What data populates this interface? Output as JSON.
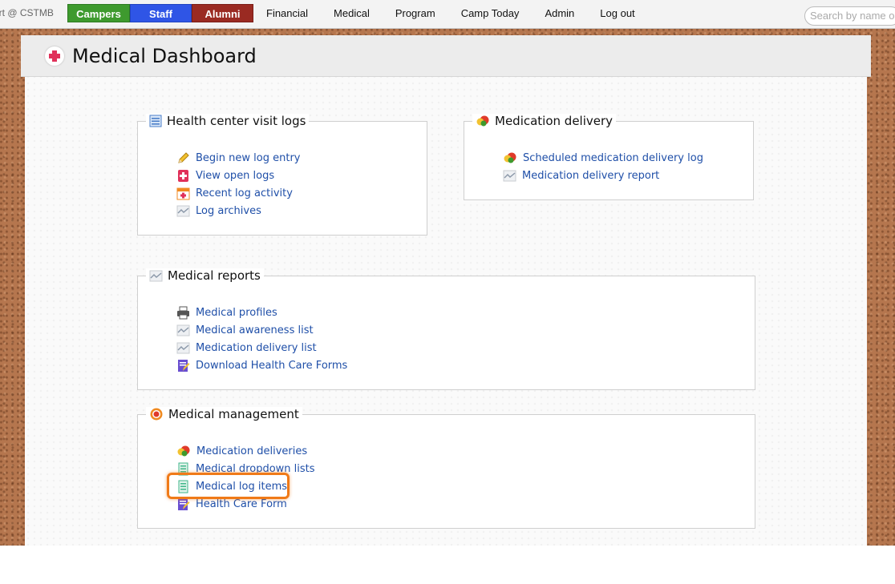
{
  "nav": {
    "brand": "ort @ CSTMB",
    "tabs": [
      "Campers",
      "Staff",
      "Alumni",
      "Financial",
      "Medical",
      "Program",
      "Camp Today",
      "Admin",
      "Log out"
    ],
    "search_placeholder": "Search by name or"
  },
  "page": {
    "title": "Medical Dashboard"
  },
  "sections": {
    "visit_logs": {
      "title": "Health center visit logs",
      "links": [
        "Begin new log entry",
        "View open logs",
        "Recent log activity",
        "Log archives"
      ]
    },
    "medication_delivery": {
      "title": "Medication delivery",
      "links": [
        "Scheduled medication delivery log",
        "Medication delivery report"
      ]
    },
    "reports": {
      "title": "Medical reports",
      "links": [
        "Medical profiles",
        "Medical awareness list",
        "Medication delivery list",
        "Download Health Care Forms"
      ]
    },
    "management": {
      "title": "Medical management",
      "links": [
        "Medication deliveries",
        "Medical dropdown lists",
        "Medical log items",
        "Health Care Form"
      ]
    }
  },
  "colors": {
    "link": "#1f4fa8",
    "highlight": "#f07a18",
    "campers": "#3e9a2e",
    "staff": "#2f55e6",
    "alumni": "#9a2a22"
  },
  "highlighted_item": "Medical log items"
}
